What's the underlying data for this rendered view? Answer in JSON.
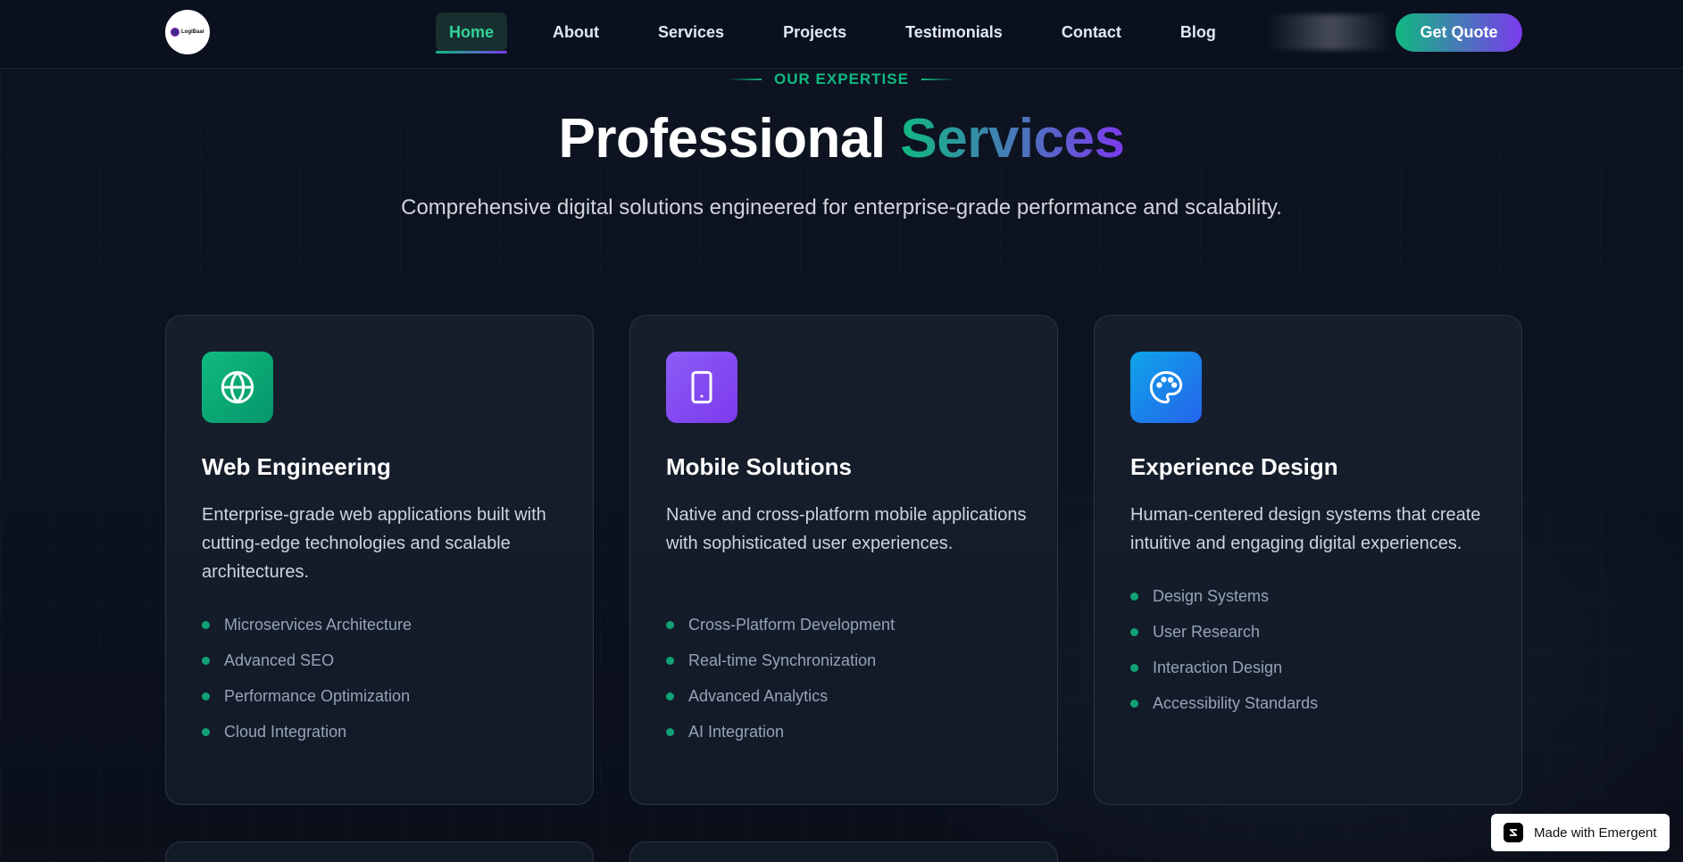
{
  "nav": {
    "logo_text": "LogiBaar",
    "links": [
      {
        "label": "Home",
        "active": true
      },
      {
        "label": "About"
      },
      {
        "label": "Services"
      },
      {
        "label": "Projects"
      },
      {
        "label": "Testimonials"
      },
      {
        "label": "Contact"
      },
      {
        "label": "Blog"
      }
    ],
    "cta_label": "Get Quote"
  },
  "hero": {
    "eyebrow": "OUR EXPERTISE",
    "title_plain": "Professional ",
    "title_gradient": "Services",
    "subtitle": "Comprehensive digital solutions engineered for enterprise-grade performance and scalability."
  },
  "cards": [
    {
      "icon": "globe-icon",
      "title": "Web Engineering",
      "description": "Enterprise-grade web applications built with cutting-edge technologies and scalable architectures.",
      "features": [
        "Microservices Architecture",
        "Advanced SEO",
        "Performance Optimization",
        "Cloud Integration"
      ]
    },
    {
      "icon": "smartphone-icon",
      "title": "Mobile Solutions",
      "description": "Native and cross-platform mobile applications with sophisticated user experiences.",
      "features": [
        "Cross-Platform Development",
        "Real-time Synchronization",
        "Advanced Analytics",
        "AI Integration"
      ]
    },
    {
      "icon": "palette-icon",
      "title": "Experience Design",
      "description": "Human-centered design systems that create intuitive and engaging digital experiences.",
      "features": [
        "Design Systems",
        "User Research",
        "Interaction Design",
        "Accessibility Standards"
      ]
    }
  ],
  "badge": {
    "label": "Made with Emergent"
  },
  "colors": {
    "accent_green": "#10b981",
    "accent_purple": "#7c3aed",
    "background": "#0b111e"
  }
}
